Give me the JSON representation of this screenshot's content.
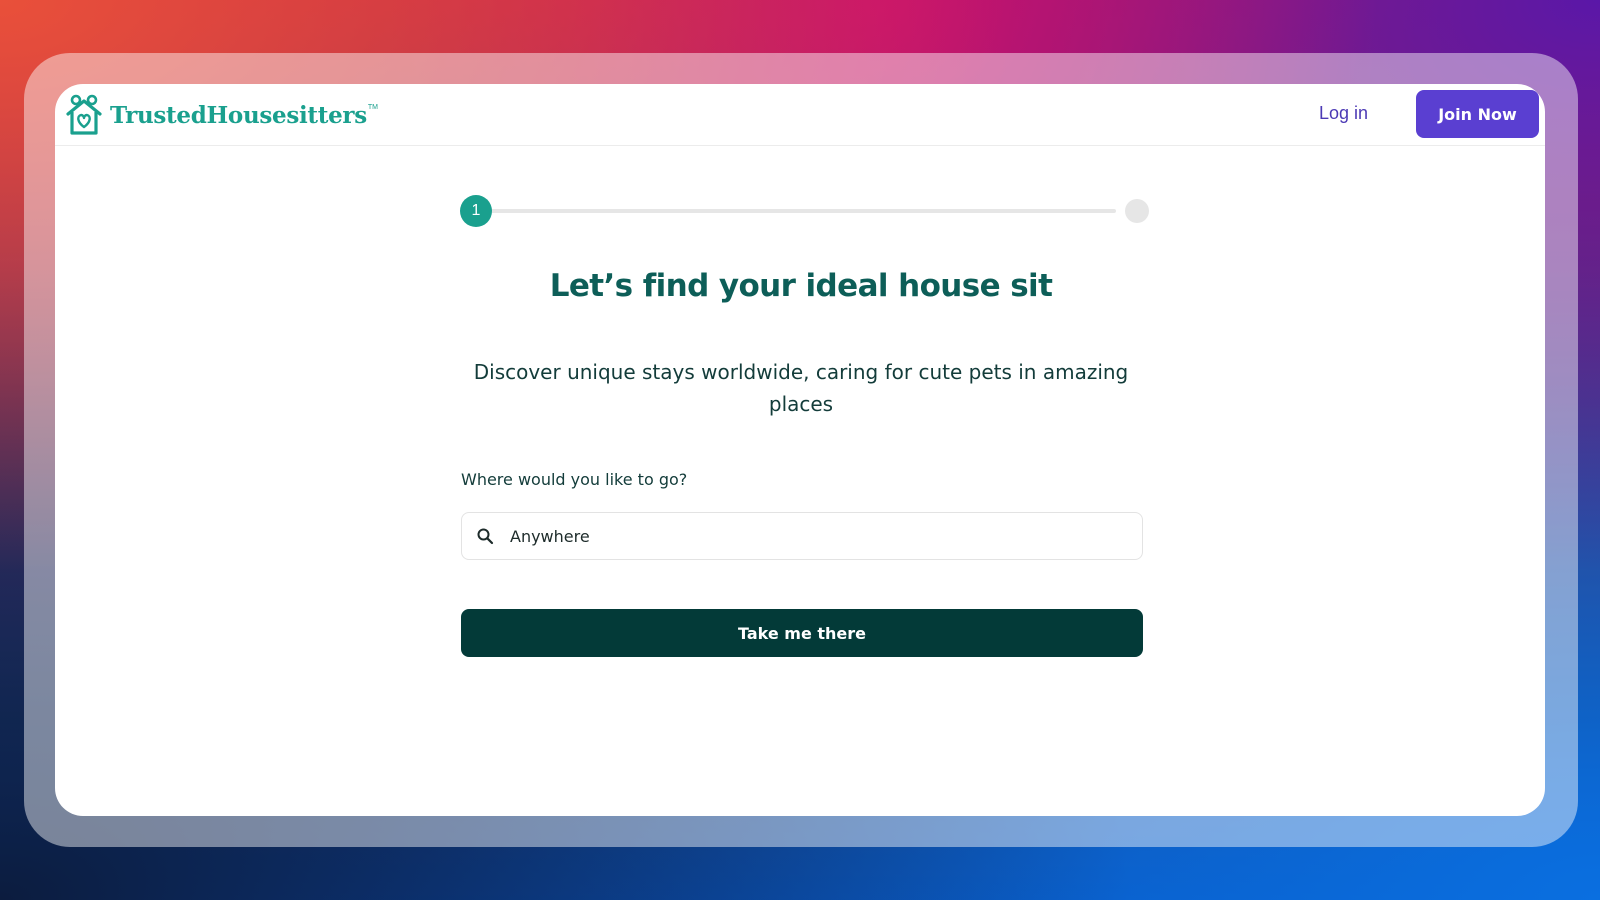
{
  "header": {
    "brand_name": "TrustedHousesitters",
    "brand_tm": "TM",
    "login_label": "Log in",
    "join_label": "Join Now"
  },
  "progress": {
    "current_step": "1"
  },
  "main": {
    "heading": "Let’s find your ideal house sit",
    "subtitle": "Discover unique stays worldwide, caring for cute pets in amazing places",
    "field_label": "Where would you like to go?",
    "search_placeholder": "Anywhere",
    "submit_label": "Take me there"
  },
  "colors": {
    "brand_teal": "#1aa08e",
    "heading_teal": "#0d5e58",
    "join_purple": "#5a3fd1",
    "cta_dark": "#033a38"
  },
  "icons": {
    "logo": "house-pets-logo-icon",
    "search": "search-icon"
  }
}
